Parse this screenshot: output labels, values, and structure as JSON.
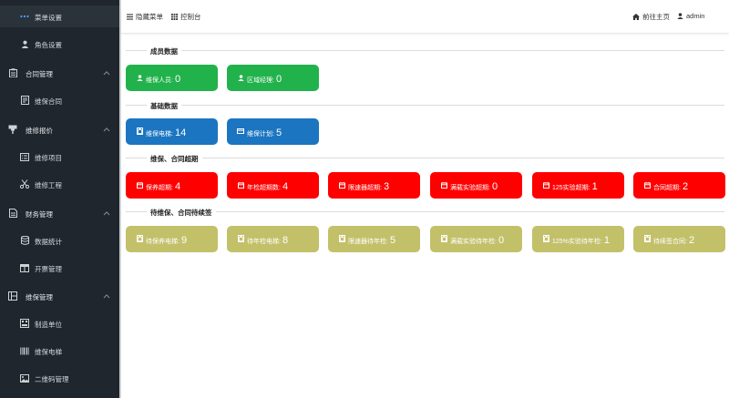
{
  "sidebar": {
    "items": [
      {
        "label": "菜单设置",
        "icon": "dots-icon",
        "level": "sub",
        "active": true
      },
      {
        "label": "角色设置",
        "icon": "user-icon",
        "level": "sub"
      },
      {
        "label": "合同管理",
        "icon": "clipboard-icon",
        "level": "group",
        "expanded": true
      },
      {
        "label": "维保合同",
        "icon": "document-icon",
        "level": "sub"
      },
      {
        "label": "维修报价",
        "icon": "flag-icon",
        "level": "group",
        "expanded": true
      },
      {
        "label": "维修项目",
        "icon": "list-icon",
        "level": "sub"
      },
      {
        "label": "维修工程",
        "icon": "scissors-icon",
        "level": "sub"
      },
      {
        "label": "财务管理",
        "icon": "file-icon",
        "level": "group",
        "expanded": true
      },
      {
        "label": "数据统计",
        "icon": "database-icon",
        "level": "sub"
      },
      {
        "label": "开票管理",
        "icon": "table-icon",
        "level": "sub"
      },
      {
        "label": "维保管理",
        "icon": "grid-icon",
        "level": "group",
        "expanded": true
      },
      {
        "label": "制造单位",
        "icon": "building-icon",
        "level": "sub"
      },
      {
        "label": "维保电梯",
        "icon": "barcode-icon",
        "level": "sub"
      },
      {
        "label": "二维码管理",
        "icon": "image-icon",
        "level": "sub"
      }
    ]
  },
  "topbar": {
    "hide_menu": "隐藏菜单",
    "dashboard": "控制台",
    "home": "前往主页",
    "user": "admin"
  },
  "sections": [
    {
      "title": "成员数据",
      "color": "#22b24c",
      "cards": [
        {
          "label": "维保人员:",
          "value": "0",
          "icon": "user-icon"
        },
        {
          "label": "区域经理:",
          "value": "0",
          "icon": "user-icon"
        }
      ]
    },
    {
      "title": "基础数据",
      "color": "#1b75c0",
      "cards": [
        {
          "label": "维保电梯:",
          "value": "14",
          "icon": "elevator-icon"
        },
        {
          "label": "维保计划:",
          "value": "5",
          "icon": "card-icon"
        }
      ]
    },
    {
      "title": "维保、合同超期",
      "color": "#ff0000",
      "cards": [
        {
          "label": "保养超期:",
          "value": "4",
          "icon": "calendar-icon"
        },
        {
          "label": "年检超期数:",
          "value": "4",
          "icon": "calendar-icon"
        },
        {
          "label": "限速器超期:",
          "value": "3",
          "icon": "calendar-icon"
        },
        {
          "label": "满载实验超期:",
          "value": "0",
          "icon": "calendar-icon"
        },
        {
          "label": "125实验超期:",
          "value": "1",
          "icon": "calendar-icon"
        },
        {
          "label": "合同超期:",
          "value": "2",
          "icon": "calendar-icon"
        }
      ]
    },
    {
      "title": "待维保、合同待续签",
      "color": "#c3c06a",
      "cards": [
        {
          "label": "待保养电梯:",
          "value": "9",
          "icon": "elevator-icon"
        },
        {
          "label": "待年检电梯:",
          "value": "8",
          "icon": "elevator-icon"
        },
        {
          "label": "限速器待年检:",
          "value": "5",
          "icon": "elevator-icon"
        },
        {
          "label": "满载实验待年检:",
          "value": "0",
          "icon": "elevator-icon"
        },
        {
          "label": "125%实验待年检:",
          "value": "1",
          "icon": "elevator-icon"
        },
        {
          "label": "待续签合同:",
          "value": "2",
          "icon": "elevator-icon"
        }
      ]
    }
  ]
}
